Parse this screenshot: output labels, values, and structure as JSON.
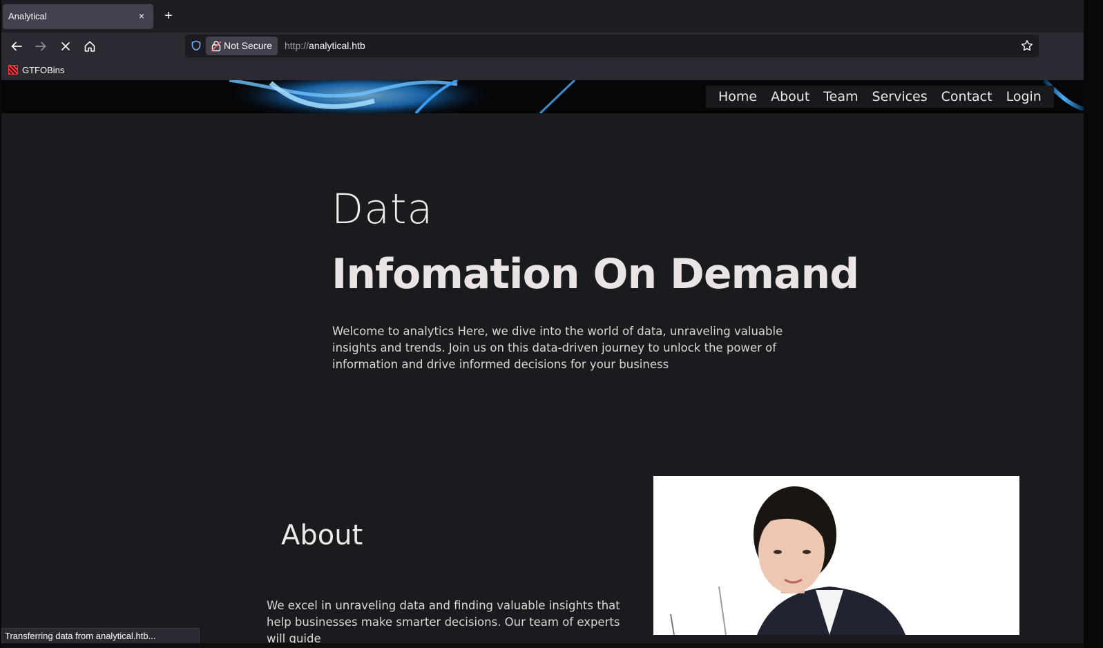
{
  "browser": {
    "tab_title": "Analytical",
    "tab_close": "×",
    "new_tab": "+",
    "security_label": "Not Secure",
    "url_scheme": "http://",
    "url_host": "analytical.htb",
    "bookmark_label": "GTFOBins",
    "status_text": "Transferring data from analytical.htb..."
  },
  "site": {
    "menu": [
      "Home",
      "About",
      "Team",
      "Services",
      "Contact",
      "Login"
    ],
    "hero_light": "Data",
    "hero_bold": "Infomation On Demand",
    "hero_text": "Welcome to analytics Here, we dive into the world of data, unraveling valuable insights and trends. Join us on this data-driven journey to unlock the power of information and drive informed decisions for your business",
    "about_title": "About",
    "about_text": "We excel in unraveling data and finding valuable insights that help businesses make smarter decisions. Our team of experts will guide"
  },
  "icons": {
    "back": "arrow-left-icon",
    "forward": "arrow-right-icon",
    "stop": "close-icon",
    "home": "home-icon",
    "shield": "shield-icon",
    "lock": "lock-icon",
    "star": "star-icon"
  },
  "colors": {
    "page_bg": "#1a1b1e",
    "toolbar_bg": "#2b2a33",
    "tabstrip_bg": "#1e1d24",
    "accent_blue": "#1e90ff"
  }
}
